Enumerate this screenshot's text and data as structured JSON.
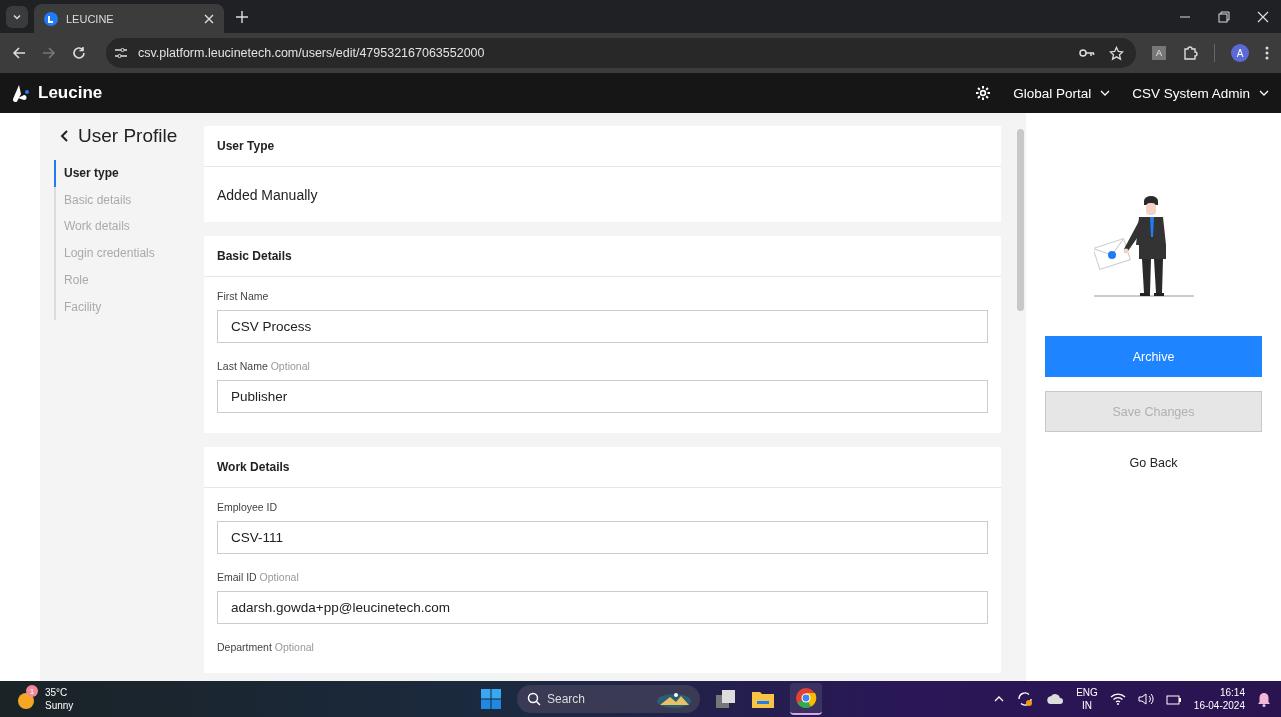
{
  "browser": {
    "tabs": [
      {
        "title": "LEUCINE",
        "selected": true
      }
    ],
    "url": "csv.platform.leucinetech.com/users/edit/479532167063552000",
    "extension_letter": "A",
    "profile_letter": "A"
  },
  "header": {
    "brand": "Leucine",
    "menus": [
      {
        "label": "Global Portal"
      },
      {
        "label": "CSV System Admin"
      }
    ]
  },
  "page": {
    "title": "User Profile",
    "nav": [
      {
        "label": "User type",
        "selected": true
      },
      {
        "label": "Basic details",
        "selected": false
      },
      {
        "label": "Work details",
        "selected": false
      },
      {
        "label": "Login credentials",
        "selected": false
      },
      {
        "label": "Role",
        "selected": false
      },
      {
        "label": "Facility",
        "selected": false
      }
    ],
    "sections": [
      {
        "title": "User Type",
        "text": "Added Manually"
      },
      {
        "title": "Basic Details",
        "fields": [
          {
            "label": "First Name",
            "value": "CSV Process"
          },
          {
            "label": "Last Name",
            "hint": "Optional",
            "value": "Publisher"
          }
        ]
      },
      {
        "title": "Work Details",
        "fields": [
          {
            "label": "Employee ID",
            "value": "CSV-111"
          },
          {
            "label": "Email ID",
            "hint": "Optional",
            "value": "adarsh.gowda+pp@leucinetech.com"
          },
          {
            "label": "Department",
            "hint": "Optional"
          }
        ]
      }
    ],
    "actions": [
      {
        "label": "Archive",
        "kind": "primary",
        "disabled": false
      },
      {
        "label": "Save Changes",
        "kind": "secondary",
        "disabled": true
      },
      {
        "label": "Go Back",
        "kind": "link",
        "disabled": false
      }
    ]
  },
  "taskbar": {
    "weather": {
      "badge": "1",
      "temperature": "35°C",
      "condition": "Sunny"
    },
    "search": {
      "placeholder": "Search"
    },
    "language": [
      "ENG",
      "IN"
    ],
    "time": "16:14",
    "date": "16-04-2024"
  }
}
